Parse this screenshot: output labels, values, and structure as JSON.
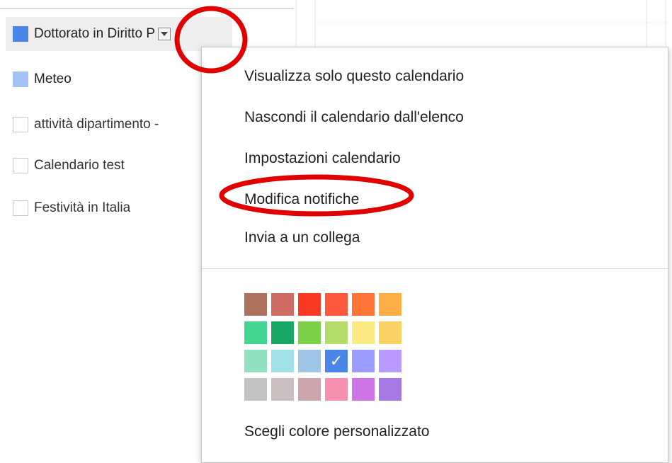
{
  "calendars": [
    {
      "label": "Dottorato in Diritto P",
      "color": "#4a86e8",
      "selected": true,
      "checked": true
    },
    {
      "label": "Meteo",
      "color": "#a4c2f4",
      "selected": false,
      "checked": true
    },
    {
      "label": "attività dipartimento -",
      "color": "",
      "selected": false,
      "checked": false
    },
    {
      "label": "Calendario test",
      "color": "",
      "selected": false,
      "checked": false
    },
    {
      "label": "Festività in Italia",
      "color": "",
      "selected": false,
      "checked": false
    }
  ],
  "menu": {
    "items": [
      "Visualizza solo questo calendario",
      "Nascondi il calendario dall'elenco",
      "Impostazioni calendario",
      "Modifica notifiche",
      "Invia a un collega"
    ],
    "custom_color_label": "Scegli colore personalizzato"
  },
  "palette": {
    "rows": [
      [
        "#ac725e",
        "#d06b64",
        "#f83a22",
        "#fa573c",
        "#ff7537",
        "#ffad46"
      ],
      [
        "#42d692",
        "#16a765",
        "#7bd148",
        "#b3dc6c",
        "#fbe983",
        "#fad165"
      ],
      [
        "#92e1c0",
        "#9fe1e7",
        "#9fc6e7",
        "#4986e7",
        "#9a9cff",
        "#b99aff"
      ],
      [
        "#c2c2c2",
        "#cabdbf",
        "#cca6ac",
        "#f691b2",
        "#cd74e6",
        "#a47ae2"
      ]
    ],
    "selected": {
      "row": 2,
      "col": 3
    },
    "check_glyph": "✓"
  },
  "annotations": {
    "color": "#e00000"
  }
}
